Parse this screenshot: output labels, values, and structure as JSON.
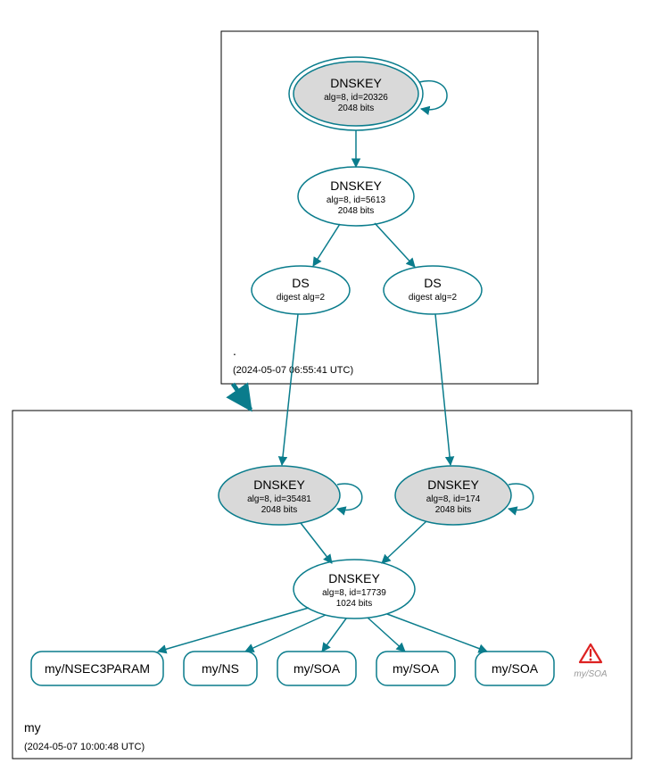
{
  "colors": {
    "stroke": "#0a7c8c",
    "fill_grey": "#d9d9d9",
    "box_border": "#000000",
    "warn_red": "#d22",
    "warn_outline": "#333"
  },
  "zones": {
    "root": {
      "name": ".",
      "timestamp": "(2024-05-07 06:55:41 UTC)"
    },
    "child": {
      "name": "my",
      "timestamp": "(2024-05-07 10:00:48 UTC)"
    }
  },
  "nodes": {
    "root_ksk": {
      "line1": "DNSKEY",
      "line2": "alg=8, id=20326",
      "line3": "2048 bits"
    },
    "root_zsk": {
      "line1": "DNSKEY",
      "line2": "alg=8, id=5613",
      "line3": "2048 bits"
    },
    "ds1": {
      "line1": "DS",
      "line2": "digest alg=2"
    },
    "ds2": {
      "line1": "DS",
      "line2": "digest alg=2"
    },
    "child_ksk1": {
      "line1": "DNSKEY",
      "line2": "alg=8, id=35481",
      "line3": "2048 bits"
    },
    "child_ksk2": {
      "line1": "DNSKEY",
      "line2": "alg=8, id=174",
      "line3": "2048 bits"
    },
    "child_zsk": {
      "line1": "DNSKEY",
      "line2": "alg=8, id=17739",
      "line3": "1024 bits"
    },
    "rr1": {
      "label": "my/NSEC3PARAM"
    },
    "rr2": {
      "label": "my/NS"
    },
    "rr3": {
      "label": "my/SOA"
    },
    "rr4": {
      "label": "my/SOA"
    },
    "rr5": {
      "label": "my/SOA"
    },
    "rr_warn": {
      "label": "my/SOA"
    }
  }
}
